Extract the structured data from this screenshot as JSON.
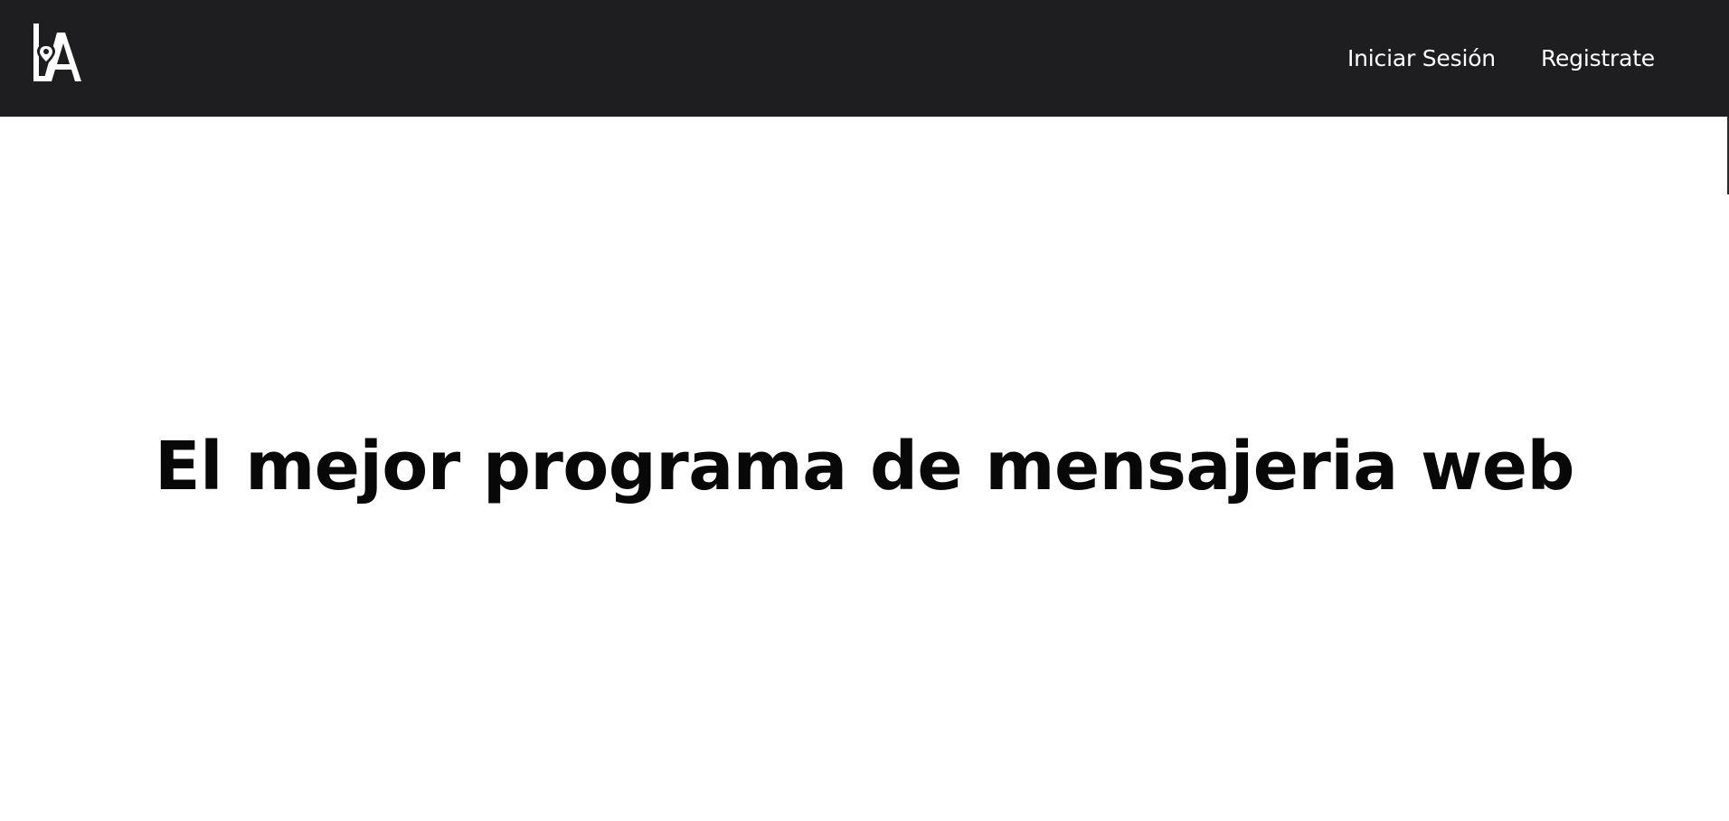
{
  "brand": {
    "logo_text": "LA",
    "logo_icon": "map-pin-icon"
  },
  "nav": {
    "items": [
      {
        "label": "Iniciar Sesión"
      },
      {
        "label": "Registrate"
      }
    ]
  },
  "hero": {
    "title": "El mejor programa de mensajeria web"
  },
  "colors": {
    "navbar_bg": "#1e1e20",
    "nav_text": "#ffffff",
    "page_bg": "#ffffff",
    "title_text": "#080808"
  }
}
